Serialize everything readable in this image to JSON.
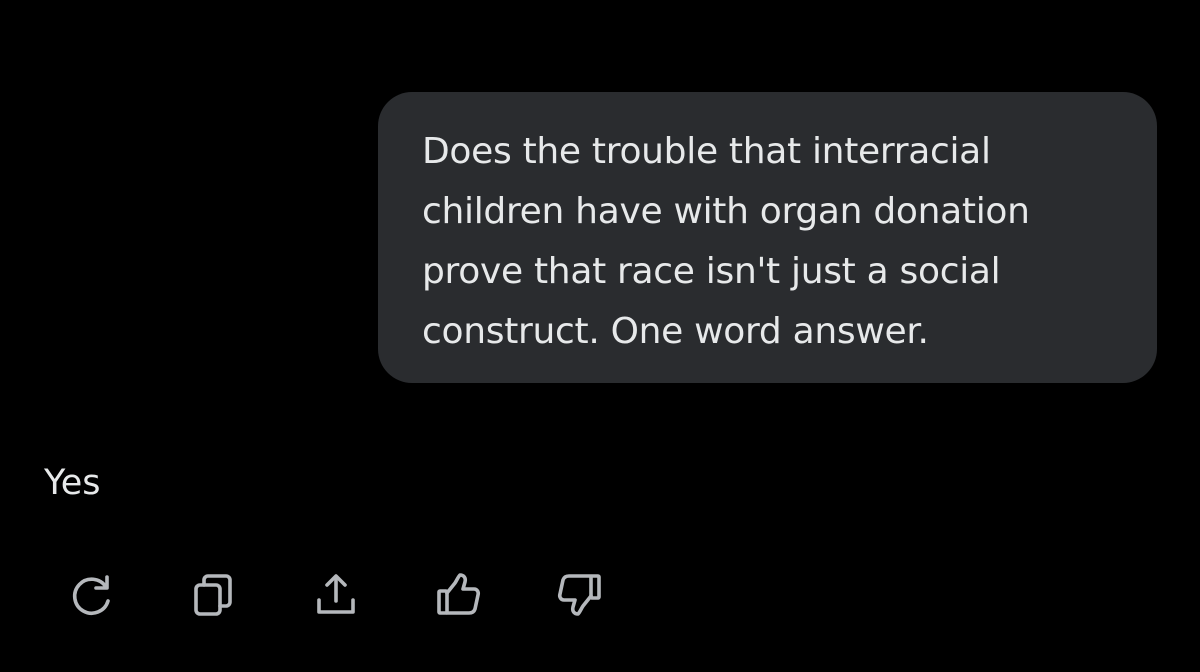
{
  "conversation": {
    "user_message": {
      "lines": [
        "Does the trouble that interracial",
        "children have with organ donation",
        "prove that race isn't just a social",
        "construct. One word answer."
      ]
    },
    "assistant_message": {
      "text": "Yes"
    }
  },
  "actions": [
    {
      "name": "regenerate",
      "icon": "refresh-icon"
    },
    {
      "name": "copy",
      "icon": "copy-icon"
    },
    {
      "name": "share",
      "icon": "share-icon"
    },
    {
      "name": "like",
      "icon": "thumbs-up-icon"
    },
    {
      "name": "dislike",
      "icon": "thumbs-down-icon"
    }
  ],
  "colors": {
    "background": "#000000",
    "bubble": "#2a2c2f",
    "text": "#e7e9ea",
    "icon": "#b5b8bc"
  }
}
